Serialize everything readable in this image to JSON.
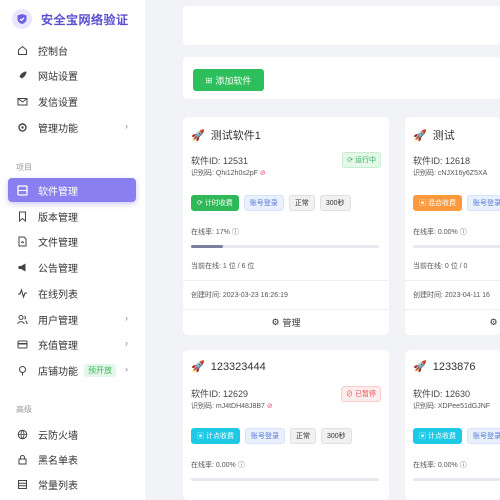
{
  "brand": {
    "title": "安全宝网络验证"
  },
  "nav": {
    "console": "控制台",
    "site_settings": "网站设置",
    "mail_settings": "发信设置",
    "manage_functions": "管理功能",
    "section_project": "项目",
    "software_manage": "软件管理",
    "version_manage": "版本管理",
    "file_manage": "文件管理",
    "notice_manage": "公告管理",
    "online_list": "在线列表",
    "user_manage": "用户管理",
    "recharge_manage": "充值管理",
    "shop_functions": "店铺功能",
    "shop_badge": "预开放",
    "section_advanced": "高级",
    "cloud_firewall": "云防火墙",
    "blacklist": "黑名单表",
    "constant_list": "常量列表"
  },
  "toolbar": {
    "add_software": "添加软件"
  },
  "cards": [
    {
      "name": "测试软件1",
      "software_id": "软件ID:  12531",
      "code": "识别码:  Qhi12h0s2pF",
      "status": "运行中",
      "status_kind": "run",
      "tags": [
        {
          "label": "计时收费",
          "kind": "green"
        },
        {
          "label": "账号登录",
          "kind": "blue"
        },
        {
          "label": "正常",
          "kind": "gray"
        },
        {
          "label": "300秒",
          "kind": "gray"
        }
      ],
      "online_rate": "在线率:  17%",
      "online_fraction": 0.17,
      "current_online": "当前在线:  1 位 / 6 位",
      "created": "创建时间:  2023-03-23 16:26:19",
      "manage": "管理"
    },
    {
      "name": "测试",
      "software_id": "软件ID:  12618",
      "code": "识别码:  cNJX16y6Z5XA",
      "tags": [
        {
          "label": "混合收费",
          "kind": "orange"
        },
        {
          "label": "账号登录",
          "kind": "blue"
        }
      ],
      "online_rate": "在线率:  0.00%",
      "current_online": "当前在线:  0 位 / 0",
      "created": "创建时间:  2023-04-11 16"
    },
    {
      "name": "123323444",
      "software_id": "软件ID:  12629",
      "code": "识别码:  mJ4tDH48J8B7",
      "status": "已暂停",
      "status_kind": "stop",
      "tags": [
        {
          "label": "计点收费",
          "kind": "cyan"
        },
        {
          "label": "账号登录",
          "kind": "blue"
        },
        {
          "label": "正常",
          "kind": "gray"
        },
        {
          "label": "300秒",
          "kind": "gray"
        }
      ],
      "online_rate": "在线率:  0.00%"
    },
    {
      "name": "1233876",
      "software_id": "软件ID:  12630",
      "code": "识别码:  XDPee51dGJNF",
      "tags": [
        {
          "label": "计点收费",
          "kind": "cyan"
        },
        {
          "label": "账号登录",
          "kind": "blue"
        }
      ],
      "online_rate": "在线率:  0.00%"
    }
  ]
}
